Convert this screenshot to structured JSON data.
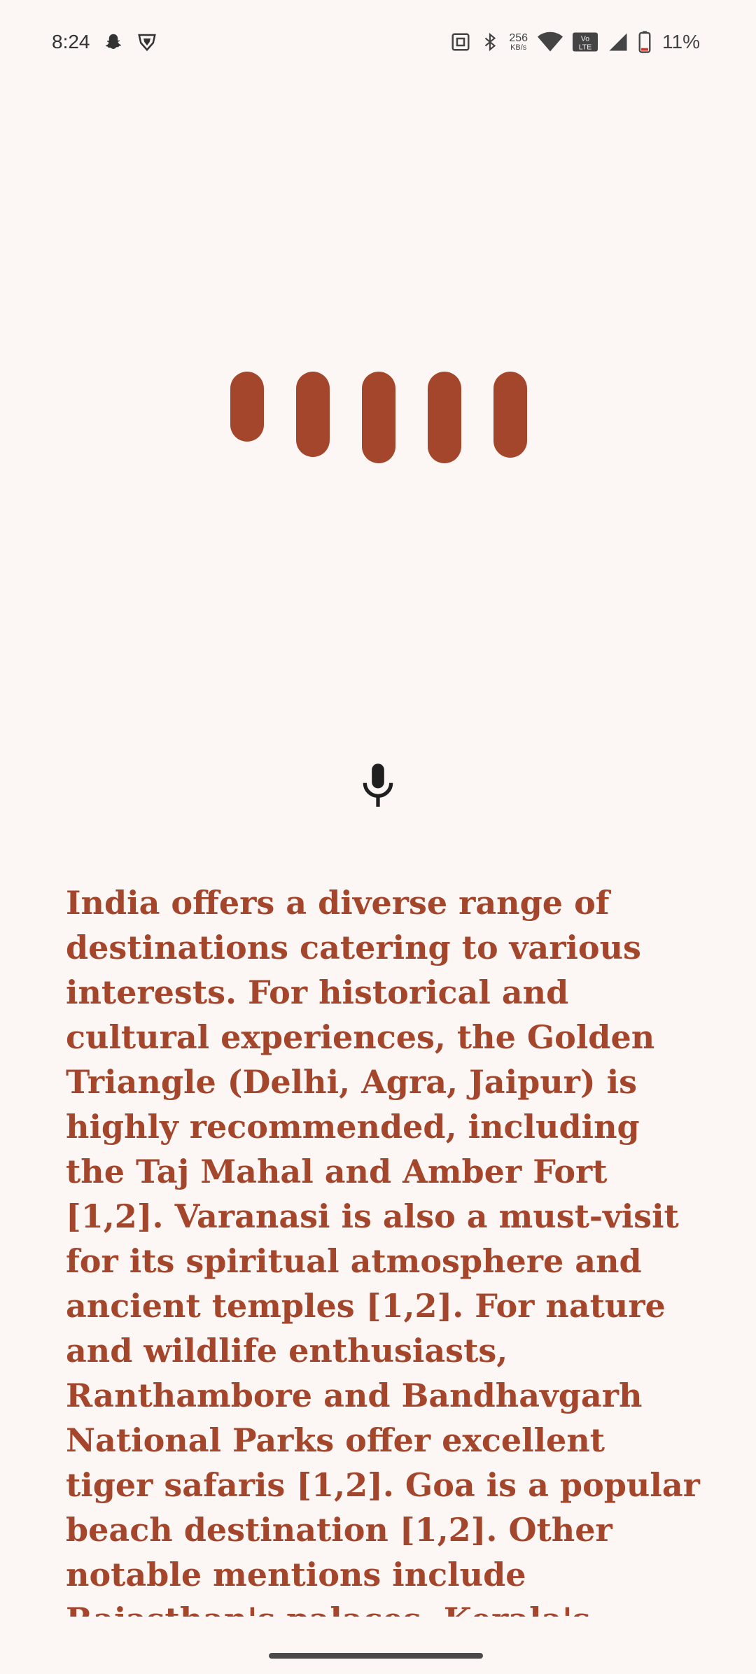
{
  "status_bar": {
    "time": "8:24",
    "network_speed_value": "256",
    "network_speed_unit": "KB/s",
    "volte_label": "Vo LTE",
    "battery_percent": "11%",
    "icons": [
      "snapchat-icon",
      "vpn-shield-icon",
      "nfc-icon",
      "bluetooth-icon",
      "wifi-icon",
      "volte-icon",
      "signal-icon",
      "battery-icon"
    ]
  },
  "visualizer": {
    "bar_color": "#A4462C",
    "bar_count": 5
  },
  "mic": {
    "icon": "microphone-icon"
  },
  "response": {
    "text": "India offers a diverse range of destinations catering to various interests. For historical and cultural experiences, the Golden Triangle (Delhi, Agra, Jaipur) is highly recommended, including the Taj Mahal and Amber Fort [1,2]. Varanasi is also a must-visit for its spiritual atmosphere and ancient temples [1,2]. For nature and wildlife enthusiasts, Ranthambore and Bandhavgarh National Parks offer excellent tiger safaris [1,2]. Goa is a popular beach destination [1,2]. Other notable mentions include Rajasthan's palaces, Kerala's backwaters, and the Himalayan"
  },
  "colors": {
    "background": "#FCF6F4",
    "accent": "#A4462C"
  }
}
